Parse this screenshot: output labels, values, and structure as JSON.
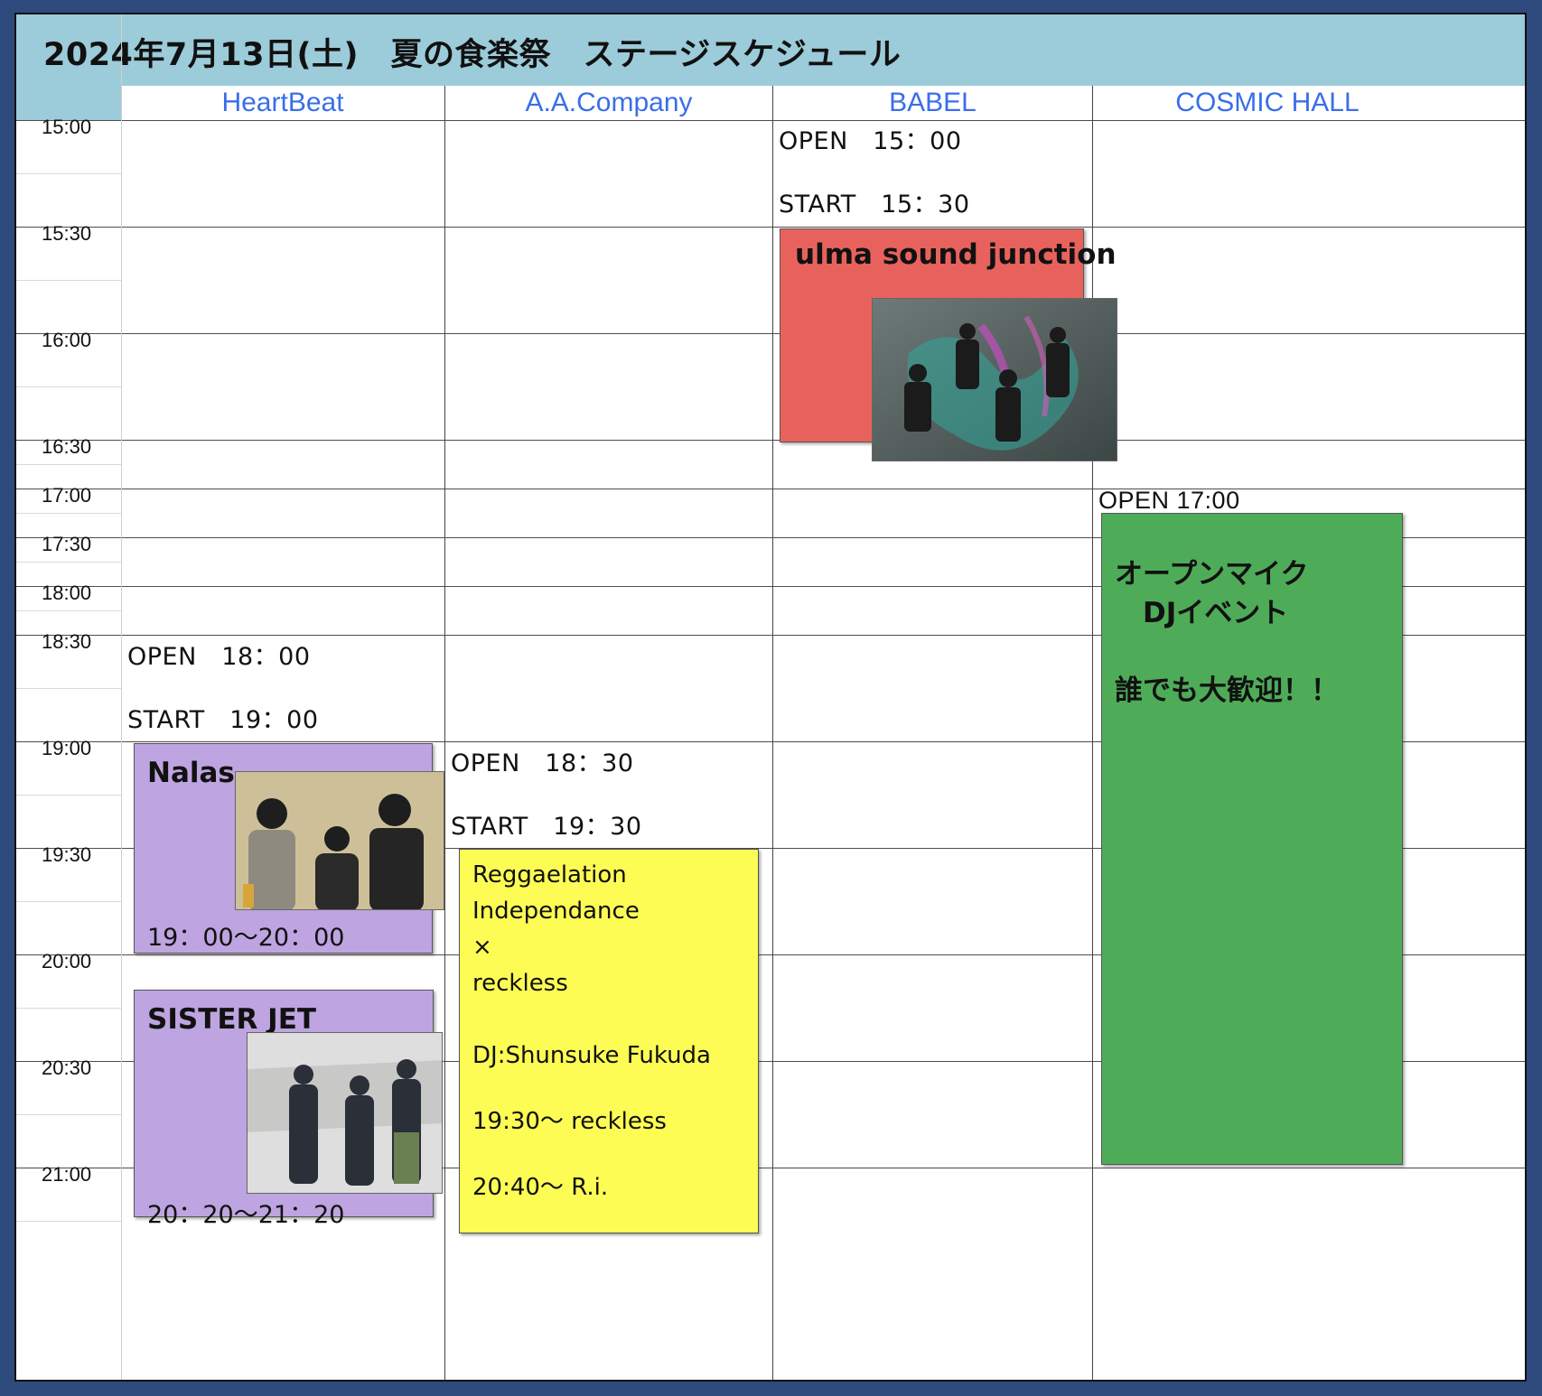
{
  "title": "2024年7月13日(土)　夏の食楽祭　ステージスケジュール",
  "venues": [
    "HeartBeat",
    "A.A.Company",
    "BABEL",
    "COSMIC HALL"
  ],
  "times": [
    "15:00",
    "15:30",
    "16:00",
    "16:30",
    "17:00",
    "17:30",
    "18:00",
    "18:30",
    "19:00",
    "19:30",
    "20:00",
    "20:30",
    "21:00"
  ],
  "babel": {
    "open": "OPEN　15：00",
    "start": "START　15：30",
    "act": "ulma sound junction"
  },
  "cosmic": {
    "open": "OPEN  17:00",
    "lines": [
      "オープンマイク",
      "　DJイベント",
      "",
      "誰でも大歓迎！！"
    ]
  },
  "heartbeat": {
    "open": "OPEN　18：00",
    "start": "START　19：00",
    "act1": {
      "name": "Nalas",
      "time": "19：00〜20：00"
    },
    "act2": {
      "name": "SISTER JET",
      "time": "20：20〜21：20"
    }
  },
  "aacompany": {
    "open": "OPEN　18：30",
    "start": "START　19：30",
    "lines": [
      "Reggaelation",
      "Independance",
      " ×",
      "reckless",
      "",
      "DJ:Shunsuke Fukuda",
      "",
      "19:30〜 reckless",
      "",
      "20:40〜 R.i."
    ]
  },
  "colors": {
    "header_bg": "#9ccbd9",
    "venue_text": "#3a6ee8",
    "babel_block": "#e8625d",
    "cosmic_block": "#4eac58",
    "heartbeat_block": "#bea4e0",
    "aacompany_block": "#fcfc55",
    "frame": "#2e4a7d"
  }
}
